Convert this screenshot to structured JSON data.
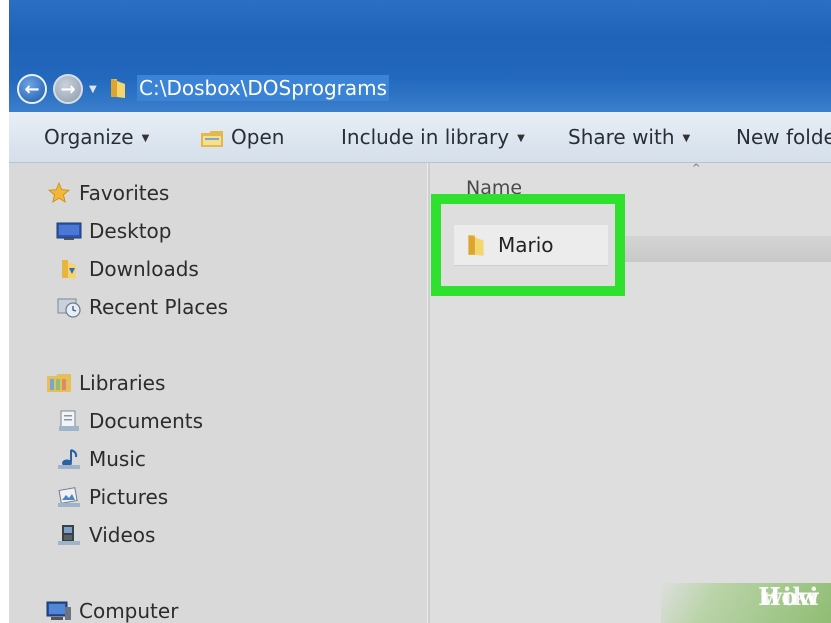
{
  "address": {
    "path": "C:\\Dosbox\\DOSprograms"
  },
  "toolbar": {
    "organize": "Organize",
    "open": "Open",
    "include_in_library": "Include in library",
    "share_with": "Share with",
    "new_folder": "New folde"
  },
  "sidebar": {
    "favorites": "Favorites",
    "desktop": "Desktop",
    "downloads": "Downloads",
    "recent_places": "Recent Places",
    "libraries": "Libraries",
    "documents": "Documents",
    "music": "Music",
    "pictures": "Pictures",
    "videos": "Videos",
    "computer": "Computer"
  },
  "content": {
    "column_name": "Name",
    "items": [
      {
        "name": "Mario",
        "icon": "folder-icon"
      }
    ]
  },
  "watermark": {
    "wiki": "wiki",
    "how": "How"
  },
  "colors": {
    "highlight": "#2fe02f",
    "titlebar": "#2268bd",
    "address_selection": "#3b83d6"
  }
}
